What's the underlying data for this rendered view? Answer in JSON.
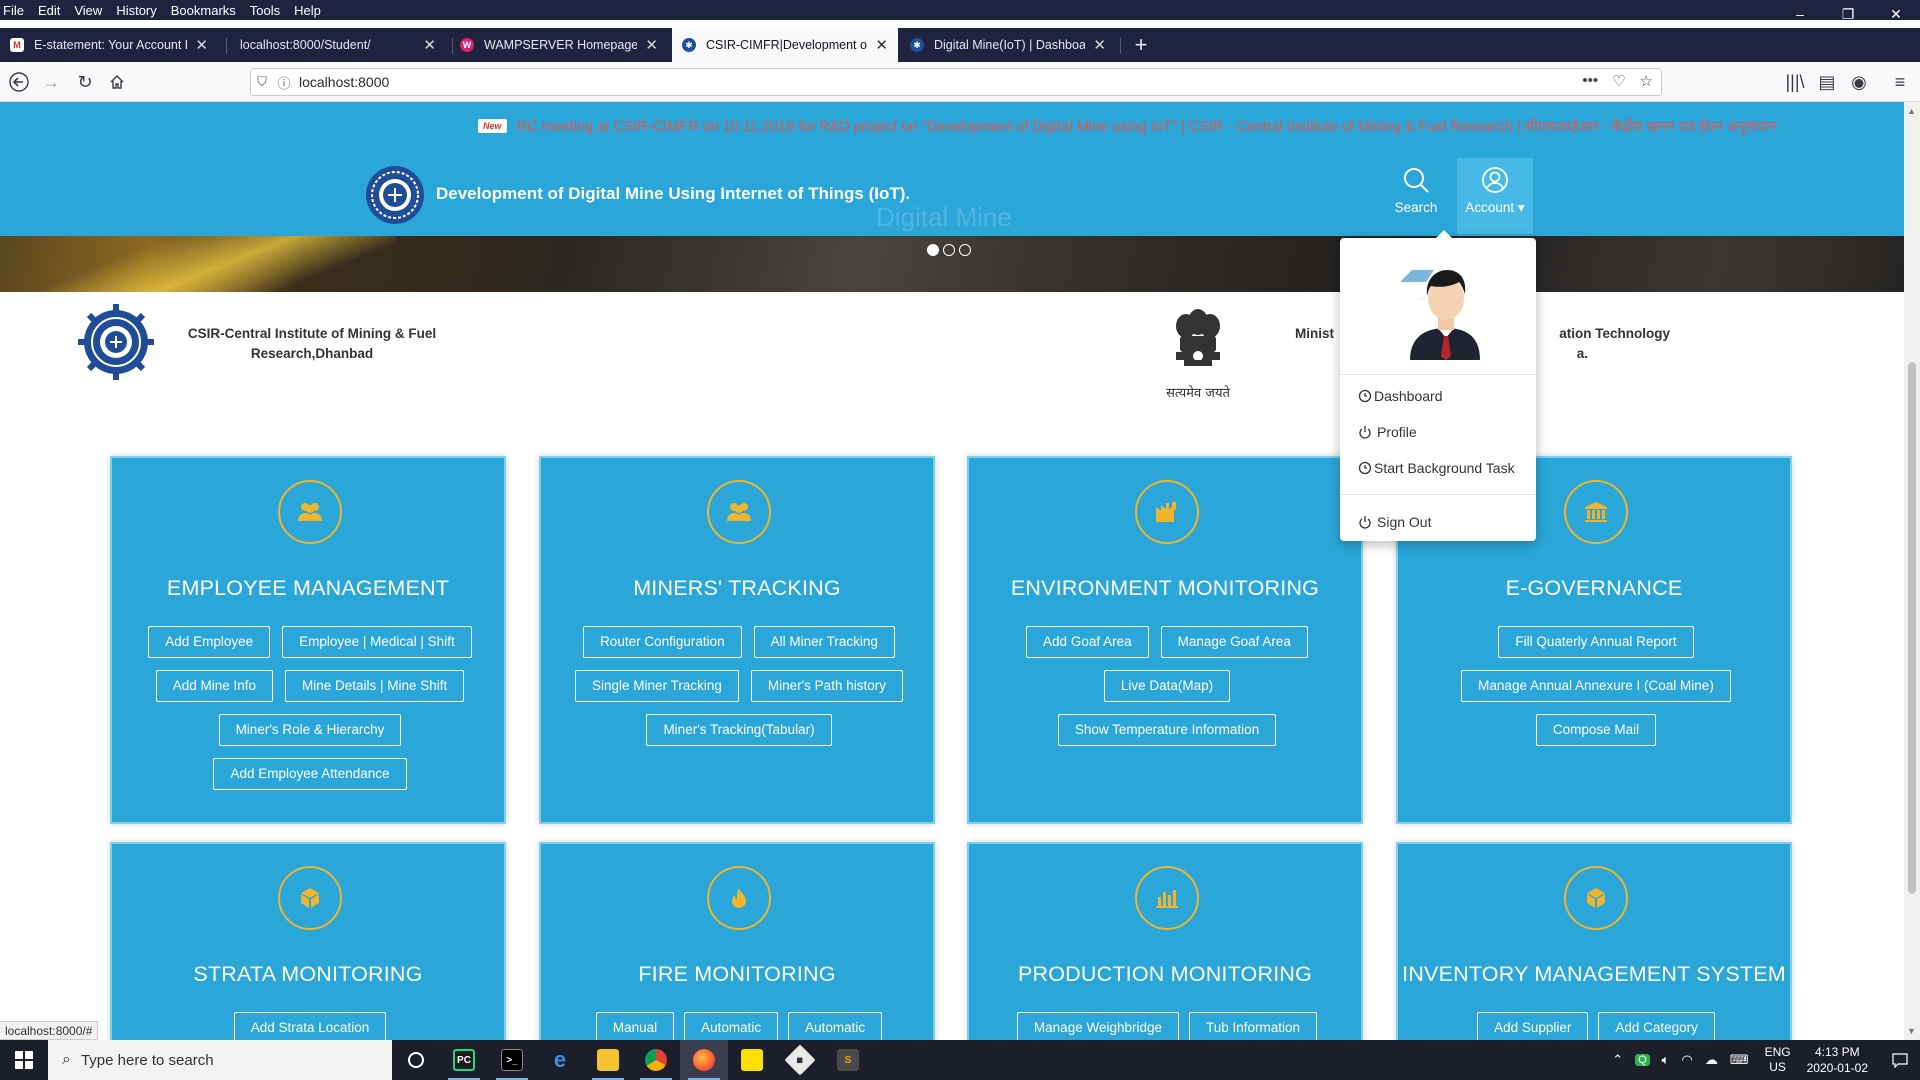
{
  "menu": [
    "File",
    "Edit",
    "View",
    "History",
    "Bookmarks",
    "Tools",
    "Help"
  ],
  "window_controls": {
    "minimize": "–",
    "restore": "❐",
    "close": "✕"
  },
  "tabs": [
    {
      "title": "E-statement: Your Account Bal",
      "favicon": "gmail-icon",
      "favicon_color": "#d93025"
    },
    {
      "title": "localhost:8000/Student/",
      "favicon": "",
      "favicon_color": ""
    },
    {
      "title": "WAMPSERVER Homepage",
      "favicon": "wampserver-icon",
      "favicon_color": "#d6246e"
    },
    {
      "title": "CSIR-CIMFR|Development of D",
      "favicon": "csir-icon",
      "favicon_color": "#1d4f9c"
    },
    {
      "title": "Digital Mine(IoT) | Dashboard",
      "favicon": "csir-icon",
      "favicon_color": "#1d4f9c"
    }
  ],
  "address": {
    "url": "localhost:8000",
    "menu_dots": "•••"
  },
  "ticker": {
    "badge": "New",
    "text": "RC meeting at CSIR-CIMFR on 10.11.2019 for R&D project on \"Development of Digital Mine using IoT\" | CSIR - Central Institute of Mining & Fuel Research | सीएसआईआर - केंद्रीय खनन एवं ईंधन अनुसंधान"
  },
  "site": {
    "title": "Development of Digital Mine Using Internet of Things (IoT).",
    "watermark": "Digital Mine",
    "search_label": "Search",
    "account_label": "Account ▾"
  },
  "org": {
    "csir_name": "CSIR-Central Institute of Mining & Fuel Research,Dhanbad",
    "emblem_caption": "सत्यमेव जयते",
    "ministry_line1": "Minist",
    "ministry_line1b": "ation Technology",
    "ministry_line2": "a."
  },
  "account_menu": {
    "items": [
      "Dashboard",
      "Profile",
      "Start Background Task"
    ],
    "signout": "Sign Out"
  },
  "cards": [
    {
      "title": "EMPLOYEE MANAGEMENT",
      "icon": "users-icon",
      "buttons": [
        "Add Employee",
        "Employee | Medical | Shift",
        "Add Mine Info",
        "Mine Details | Mine Shift",
        "Miner's Role & Hierarchy",
        "Add Employee Attendance"
      ]
    },
    {
      "title": "MINERS' TRACKING",
      "icon": "users-icon",
      "buttons": [
        "Router Configuration",
        "All Miner Tracking",
        "Single Miner Tracking",
        "Miner's Path history",
        "Miner's Tracking(Tabular)"
      ]
    },
    {
      "title": "ENVIRONMENT MONITORING",
      "icon": "factory-icon",
      "buttons": [
        "Add Goaf Area",
        "Manage Goaf Area",
        "Live Data(Map)",
        "Show Temperature Information"
      ]
    },
    {
      "title": "E-GOVERNANCE",
      "icon": "bank-icon",
      "buttons": [
        "Fill Quaterly Annual Report",
        "Manage Annual Annexure I (Coal Mine)",
        "Compose Mail"
      ]
    },
    {
      "title": "STRATA MONITORING",
      "icon": "cube-icon",
      "buttons": [
        "Add Strata Location"
      ]
    },
    {
      "title": "FIRE MONITORING",
      "icon": "fire-icon",
      "buttons": [
        "Manual",
        "Automatic",
        "Automatic"
      ]
    },
    {
      "title": "PRODUCTION MONITORING",
      "icon": "bar-chart-icon",
      "buttons": [
        "Manage Weighbridge",
        "Tub Information"
      ]
    },
    {
      "title": "INVENTORY MANAGEMENT SYSTEM",
      "icon": "cube-icon",
      "buttons": [
        "Add Supplier",
        "Add Category"
      ]
    }
  ],
  "status_url": "localhost:8000/#",
  "taskbar": {
    "search_placeholder": "Type here to search",
    "lang": "ENG",
    "region": "US",
    "time": "4:13 PM",
    "date": "2020-01-02"
  },
  "colors": {
    "header_blue": "#2aa6d9",
    "icon_gold": "#f0b52c",
    "ticker_red": "#e0564f"
  }
}
